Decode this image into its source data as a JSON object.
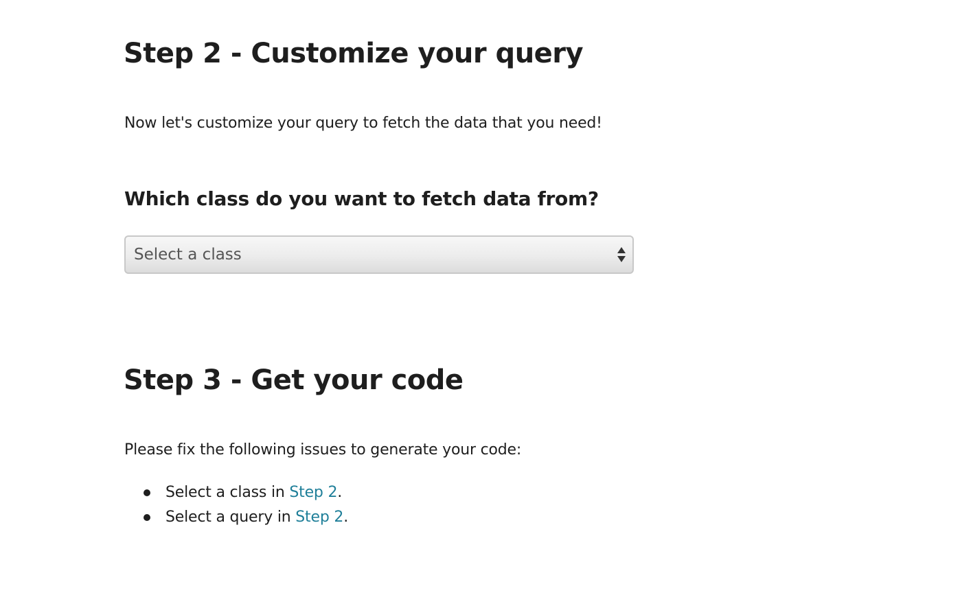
{
  "step2": {
    "title": "Step 2 - Customize your query",
    "intro": "Now let's customize your query to fetch the data that you need!",
    "question": "Which class do you want to fetch data from?",
    "class_select": {
      "placeholder": "Select a class",
      "selected": "Select a class"
    }
  },
  "step3": {
    "title": "Step 3 - Get your code",
    "intro": "Please fix the following issues to generate your code:",
    "issues": [
      {
        "prefix": "Select a class in ",
        "link": "Step 2",
        "suffix": "."
      },
      {
        "prefix": "Select a query in ",
        "link": "Step 2",
        "suffix": "."
      }
    ]
  },
  "colors": {
    "text": "#1e1e1e",
    "link": "#1f7f99",
    "select_border": "#c8c8c8",
    "select_text": "#555555"
  }
}
